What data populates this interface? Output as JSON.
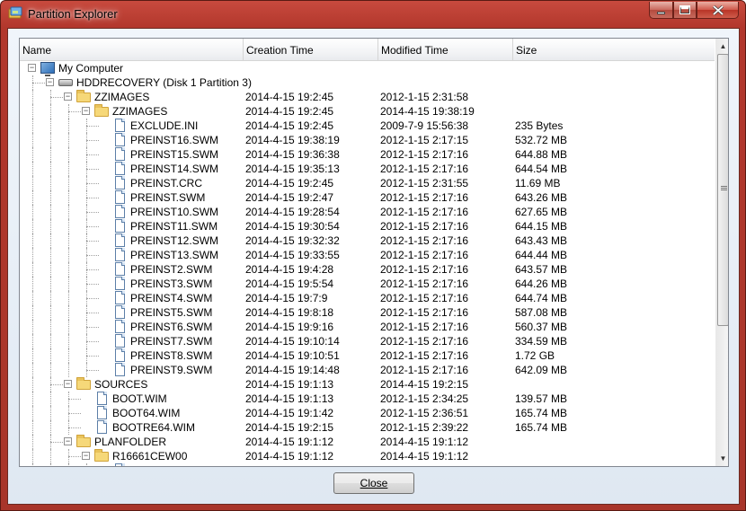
{
  "window": {
    "title": "Partition Explorer"
  },
  "columns": {
    "name": "Name",
    "creation": "Creation Time",
    "modified": "Modified Time",
    "size": "Size"
  },
  "rows": [
    {
      "name": "My Computer",
      "creation": "",
      "modified": "",
      "size": "",
      "icon": "computer-icon",
      "depth": 0,
      "expander": "minus"
    },
    {
      "name": "HDDRECOVERY (Disk 1 Partition 3)",
      "creation": "",
      "modified": "",
      "size": "",
      "icon": "disk-icon",
      "depth": 1,
      "expander": "minus"
    },
    {
      "name": "ZZIMAGES",
      "creation": "2014-4-15 19:2:45",
      "modified": "2012-1-15 2:31:58",
      "size": "",
      "icon": "folder-icon",
      "depth": 2,
      "expander": "minus"
    },
    {
      "name": "ZZIMAGES",
      "creation": "2014-4-15 19:2:45",
      "modified": "2014-4-15 19:38:19",
      "size": "",
      "icon": "folder-icon",
      "depth": 3,
      "expander": "minus"
    },
    {
      "name": "EXCLUDE.INI",
      "creation": "2014-4-15 19:2:45",
      "modified": "2009-7-9 15:56:38",
      "size": "235 Bytes",
      "icon": "file-icon",
      "depth": 4
    },
    {
      "name": "PREINST16.SWM",
      "creation": "2014-4-15 19:38:19",
      "modified": "2012-1-15 2:17:15",
      "size": "532.72 MB",
      "icon": "file-icon",
      "depth": 4
    },
    {
      "name": "PREINST15.SWM",
      "creation": "2014-4-15 19:36:38",
      "modified": "2012-1-15 2:17:16",
      "size": "644.88 MB",
      "icon": "file-icon",
      "depth": 4
    },
    {
      "name": "PREINST14.SWM",
      "creation": "2014-4-15 19:35:13",
      "modified": "2012-1-15 2:17:16",
      "size": "644.54 MB",
      "icon": "file-icon",
      "depth": 4
    },
    {
      "name": "PREINST.CRC",
      "creation": "2014-4-15 19:2:45",
      "modified": "2012-1-15 2:31:55",
      "size": "11.69 MB",
      "icon": "file-icon",
      "depth": 4
    },
    {
      "name": "PREINST.SWM",
      "creation": "2014-4-15 19:2:47",
      "modified": "2012-1-15 2:17:16",
      "size": "643.26 MB",
      "icon": "file-icon",
      "depth": 4
    },
    {
      "name": "PREINST10.SWM",
      "creation": "2014-4-15 19:28:54",
      "modified": "2012-1-15 2:17:16",
      "size": "627.65 MB",
      "icon": "file-icon",
      "depth": 4
    },
    {
      "name": "PREINST11.SWM",
      "creation": "2014-4-15 19:30:54",
      "modified": "2012-1-15 2:17:16",
      "size": "644.15 MB",
      "icon": "file-icon",
      "depth": 4
    },
    {
      "name": "PREINST12.SWM",
      "creation": "2014-4-15 19:32:32",
      "modified": "2012-1-15 2:17:16",
      "size": "643.43 MB",
      "icon": "file-icon",
      "depth": 4
    },
    {
      "name": "PREINST13.SWM",
      "creation": "2014-4-15 19:33:55",
      "modified": "2012-1-15 2:17:16",
      "size": "644.44 MB",
      "icon": "file-icon",
      "depth": 4
    },
    {
      "name": "PREINST2.SWM",
      "creation": "2014-4-15 19:4:28",
      "modified": "2012-1-15 2:17:16",
      "size": "643.57 MB",
      "icon": "file-icon",
      "depth": 4
    },
    {
      "name": "PREINST3.SWM",
      "creation": "2014-4-15 19:5:54",
      "modified": "2012-1-15 2:17:16",
      "size": "644.26 MB",
      "icon": "file-icon",
      "depth": 4
    },
    {
      "name": "PREINST4.SWM",
      "creation": "2014-4-15 19:7:9",
      "modified": "2012-1-15 2:17:16",
      "size": "644.74 MB",
      "icon": "file-icon",
      "depth": 4
    },
    {
      "name": "PREINST5.SWM",
      "creation": "2014-4-15 19:8:18",
      "modified": "2012-1-15 2:17:16",
      "size": "587.08 MB",
      "icon": "file-icon",
      "depth": 4
    },
    {
      "name": "PREINST6.SWM",
      "creation": "2014-4-15 19:9:16",
      "modified": "2012-1-15 2:17:16",
      "size": "560.37 MB",
      "icon": "file-icon",
      "depth": 4
    },
    {
      "name": "PREINST7.SWM",
      "creation": "2014-4-15 19:10:14",
      "modified": "2012-1-15 2:17:16",
      "size": "334.59 MB",
      "icon": "file-icon",
      "depth": 4
    },
    {
      "name": "PREINST8.SWM",
      "creation": "2014-4-15 19:10:51",
      "modified": "2012-1-15 2:17:16",
      "size": "1.72 GB",
      "icon": "file-icon",
      "depth": 4
    },
    {
      "name": "PREINST9.SWM",
      "creation": "2014-4-15 19:14:48",
      "modified": "2012-1-15 2:17:16",
      "size": "642.09 MB",
      "icon": "file-icon",
      "depth": 4
    },
    {
      "name": "SOURCES",
      "creation": "2014-4-15 19:1:13",
      "modified": "2014-4-15 19:2:15",
      "size": "",
      "icon": "folder-icon",
      "depth": 2,
      "expander": "minus"
    },
    {
      "name": "BOOT.WIM",
      "creation": "2014-4-15 19:1:13",
      "modified": "2012-1-15 2:34:25",
      "size": "139.57 MB",
      "icon": "file-icon",
      "depth": 3
    },
    {
      "name": "BOOT64.WIM",
      "creation": "2014-4-15 19:1:42",
      "modified": "2012-1-15 2:36:51",
      "size": "165.74 MB",
      "icon": "file-icon",
      "depth": 3
    },
    {
      "name": "BOOTRE64.WIM",
      "creation": "2014-4-15 19:2:15",
      "modified": "2012-1-15 2:39:22",
      "size": "165.74 MB",
      "icon": "file-icon",
      "depth": 3
    },
    {
      "name": "PLANFOLDER",
      "creation": "2014-4-15 19:1:12",
      "modified": "2014-4-15 19:1:12",
      "size": "",
      "icon": "folder-icon",
      "depth": 2,
      "expander": "minus"
    },
    {
      "name": "R16661CEW00",
      "creation": "2014-4-15 19:1:12",
      "modified": "2014-4-15 19:1:12",
      "size": "",
      "icon": "folder-icon",
      "depth": 3,
      "expander": "minus"
    },
    {
      "name": "",
      "creation": "",
      "modified": "",
      "size": "",
      "icon": "file-icon",
      "depth": 4
    }
  ],
  "footer": {
    "close_label": "Close"
  }
}
